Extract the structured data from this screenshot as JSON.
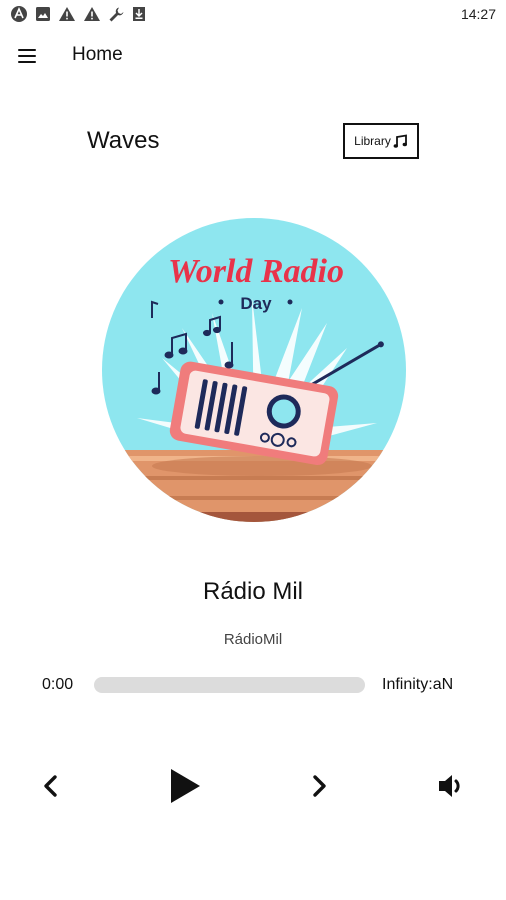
{
  "status_bar": {
    "time": "14:27",
    "icons": [
      "app-notification-icon",
      "image-notification-icon",
      "warning-icon",
      "warning-icon",
      "wrench-icon",
      "download-icon"
    ]
  },
  "app_bar": {
    "title": "Home",
    "menu_icon": "hamburger-menu-icon"
  },
  "header": {
    "brand": "Waves",
    "library_label": "Library",
    "library_icon": "music-note-icon"
  },
  "cover_art": {
    "title_line1": "World Radio",
    "title_line2": "Day",
    "colors": {
      "sky": "#8ee6ef",
      "title": "#e8334a",
      "subtitle": "#1e2a5a",
      "radio_body": "#f07c7c",
      "table": "#e0956a"
    }
  },
  "player": {
    "station_name": "Rádio Mil",
    "station_subtitle": "RádioMil",
    "current_time": "0:00",
    "duration": "Infinity:aN",
    "progress": 0
  },
  "controls": {
    "previous_icon": "chevron-left-icon",
    "play_icon": "play-icon",
    "next_icon": "chevron-right-icon",
    "volume_icon": "volume-icon"
  }
}
